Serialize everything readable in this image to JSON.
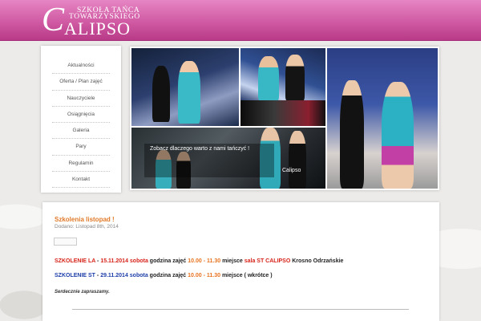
{
  "header": {
    "logo_letter": "C",
    "logo_line1": "SZKOŁA TAŃCA",
    "logo_line2": "TOWARZYSKIEGO",
    "logo_name": "ALIPSO"
  },
  "menu": {
    "items": [
      "Aktualności",
      "Oferta / Plan zajęć",
      "Nauczyciele",
      "Osiągnięcia",
      "Galeria",
      "Pary",
      "Regulamin",
      "Kontakt"
    ]
  },
  "slider": {
    "caption": "Zobacz dlaczego warto z nami tańczyć !",
    "name": "Calipso",
    "dots": "••••••••••••••••"
  },
  "post": {
    "title": "Szkolenia listopad !",
    "date": "Dodano: Listopad 8th, 2014",
    "line1": {
      "label": "SZKOLENIE LA",
      "dash": " - ",
      "date": "15.11.2014 sobota",
      "text1": " godzina zajęć ",
      "time": "10.00 - 11.30",
      "text2": " miejsce ",
      "place": "sala ST CALIPSO",
      "text3": " Krosno Odrzańskie"
    },
    "line2": {
      "label": "SZKOLENIE ST",
      "dash": " - ",
      "date": "29.11.2014 sobota",
      "text1": " godzina zajęć ",
      "time": "10.00 - 11.30",
      "text2": " miejsce ( wkrótce )"
    },
    "regards": "Serdecznie zapraszamy."
  },
  "colors": {
    "header_pink": "#d05aa3",
    "title_orange": "#e07a2a",
    "accent_red": "#d8231a",
    "accent_orange": "#e8731f",
    "accent_blue": "#1d3ea8"
  }
}
